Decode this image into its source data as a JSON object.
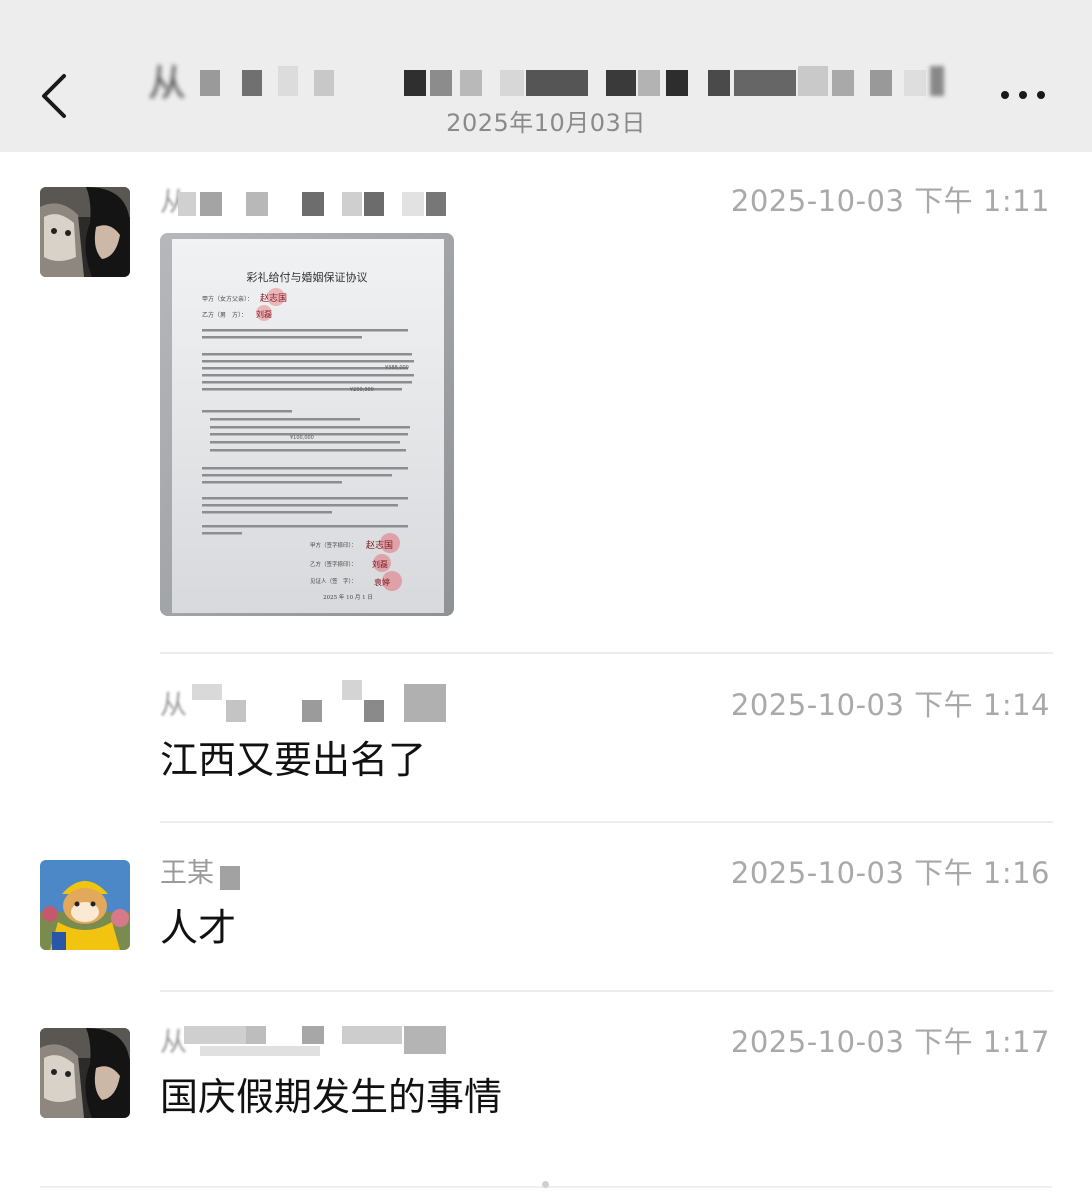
{
  "header": {
    "title_visible_prefix": "从",
    "title_suffix": "",
    "subtitle": "2025年10月03日"
  },
  "messages": [
    {
      "sender_prefix": "从",
      "time": "2025-10-03 下午 1:11",
      "type": "image",
      "image": {
        "doc_title": "彩礼给付与婚姻保证协议",
        "party_a": "甲方（女方父亲）：",
        "party_b": "乙方（男　方）：",
        "sign_a": "赵志国",
        "sign_b": "刘磊",
        "witness": "见证人（签　字）：",
        "sign_w": "袁婷",
        "amount_1": "¥388,000",
        "amount_2": "¥100,000",
        "amount_3": "¥200,000",
        "sign_label_a": "甲方（签字捺印）：",
        "sign_label_b": "乙方（签字捺印）：",
        "date": "2025 年 10 月 1 日"
      }
    },
    {
      "sender_prefix": "从",
      "time": "2025-10-03 下午 1:14",
      "type": "text",
      "text": "江西又要出名了"
    },
    {
      "sender_prefix": "王某",
      "time": "2025-10-03 下午 1:16",
      "type": "text",
      "text": "人才"
    },
    {
      "sender_prefix": "从",
      "time": "2025-10-03 下午 1:17",
      "type": "text",
      "text": "国庆假期发生的事情"
    }
  ],
  "icons": {
    "back": "chevron-left-icon",
    "more": "more-dots-icon"
  },
  "colors": {
    "header_bg": "#ededed",
    "time_gray": "#a9a9a9",
    "seal_red": "#d9534f"
  }
}
